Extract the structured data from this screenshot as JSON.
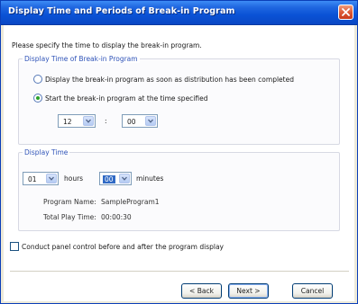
{
  "window": {
    "title": "Display Time and Periods of Break-in Program"
  },
  "intro_text": "Please specify the time to display the break-in program.",
  "display_time_group": {
    "title": "Display Time of Break-in Program",
    "options": [
      {
        "label": "Display the break-in program as soon as distribution has been completed",
        "checked": false
      },
      {
        "label": "Start the break-in program at the time specified",
        "checked": true
      }
    ],
    "hour_value": "12",
    "minute_value": "00",
    "separator": ":"
  },
  "duration_group": {
    "title": "Display Time",
    "hours_value": "01",
    "hours_label": "hours",
    "minutes_value": "00",
    "minutes_label": "minutes",
    "program_name_label": "Program Name:",
    "program_name_value": "SampleProgram1",
    "total_play_time_label": "Total Play Time:",
    "total_play_time_value": "00:00:30"
  },
  "panel_control": {
    "label": "Conduct panel control before and after the program display",
    "checked": false
  },
  "buttons": {
    "back": "< Back",
    "next": "Next >",
    "cancel": "Cancel"
  },
  "colors": {
    "title_bar": "#0a52d6",
    "group_title": "#2f53b8",
    "close_button": "#dd5b37",
    "selection": "#316ac5"
  },
  "icons": {
    "close": "close-icon",
    "dropdown": "chevron-down-icon"
  }
}
